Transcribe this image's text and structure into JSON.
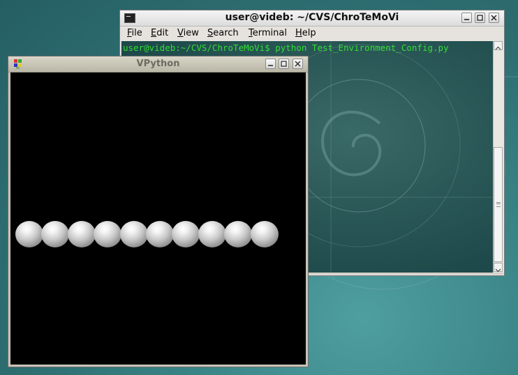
{
  "terminal": {
    "title": "user@videb: ~/CVS/ChroTeMoVi",
    "menu": [
      {
        "underline": "F",
        "rest": "ile"
      },
      {
        "underline": "E",
        "rest": "dit"
      },
      {
        "underline": "V",
        "rest": "iew"
      },
      {
        "underline": "S",
        "rest": "earch"
      },
      {
        "underline": "T",
        "rest": "erminal"
      },
      {
        "underline": "H",
        "rest": "elp"
      }
    ],
    "output_line": "user@videb:~/CVS/ChroTeMoVi$ python Test_Environment_Config.py",
    "text_color": "#33e033"
  },
  "vpython": {
    "title": "VPython",
    "sphere_count": 10,
    "canvas_color": "#000000"
  },
  "icons": [
    "terminal-app-icon",
    "minimize-icon",
    "maximize-icon",
    "close-icon",
    "scroll-up-icon",
    "scroll-down-icon",
    "vpython-app-icon"
  ]
}
